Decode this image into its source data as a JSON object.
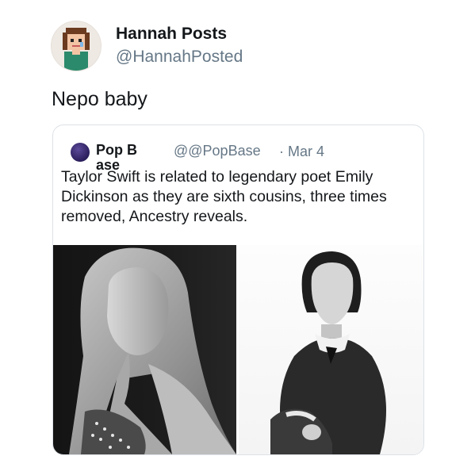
{
  "author": {
    "name": "Hannah Posts",
    "handle": "@HannahPosted",
    "avatar_icon": "pixel-art-avatar-icon"
  },
  "tweet": {
    "text": "Nepo baby"
  },
  "quoted": {
    "name": "Pop Base",
    "handle": "@@PopBase",
    "date": "· Mar 4",
    "avatar_icon": "pop-base-logo-icon",
    "text": "Taylor Swift is related to legendary poet Emily Dickinson as they are sixth cousins, three times removed, Ancestry reveals.",
    "images": [
      {
        "name": "taylor-swift-photo",
        "tone": "black-and-white"
      },
      {
        "name": "emily-dickinson-portrait",
        "tone": "black-and-white"
      }
    ]
  },
  "colors": {
    "primary_text": "#14171a",
    "secondary_text": "#657786",
    "card_border": "#dde2e7",
    "background": "#ffffff"
  }
}
